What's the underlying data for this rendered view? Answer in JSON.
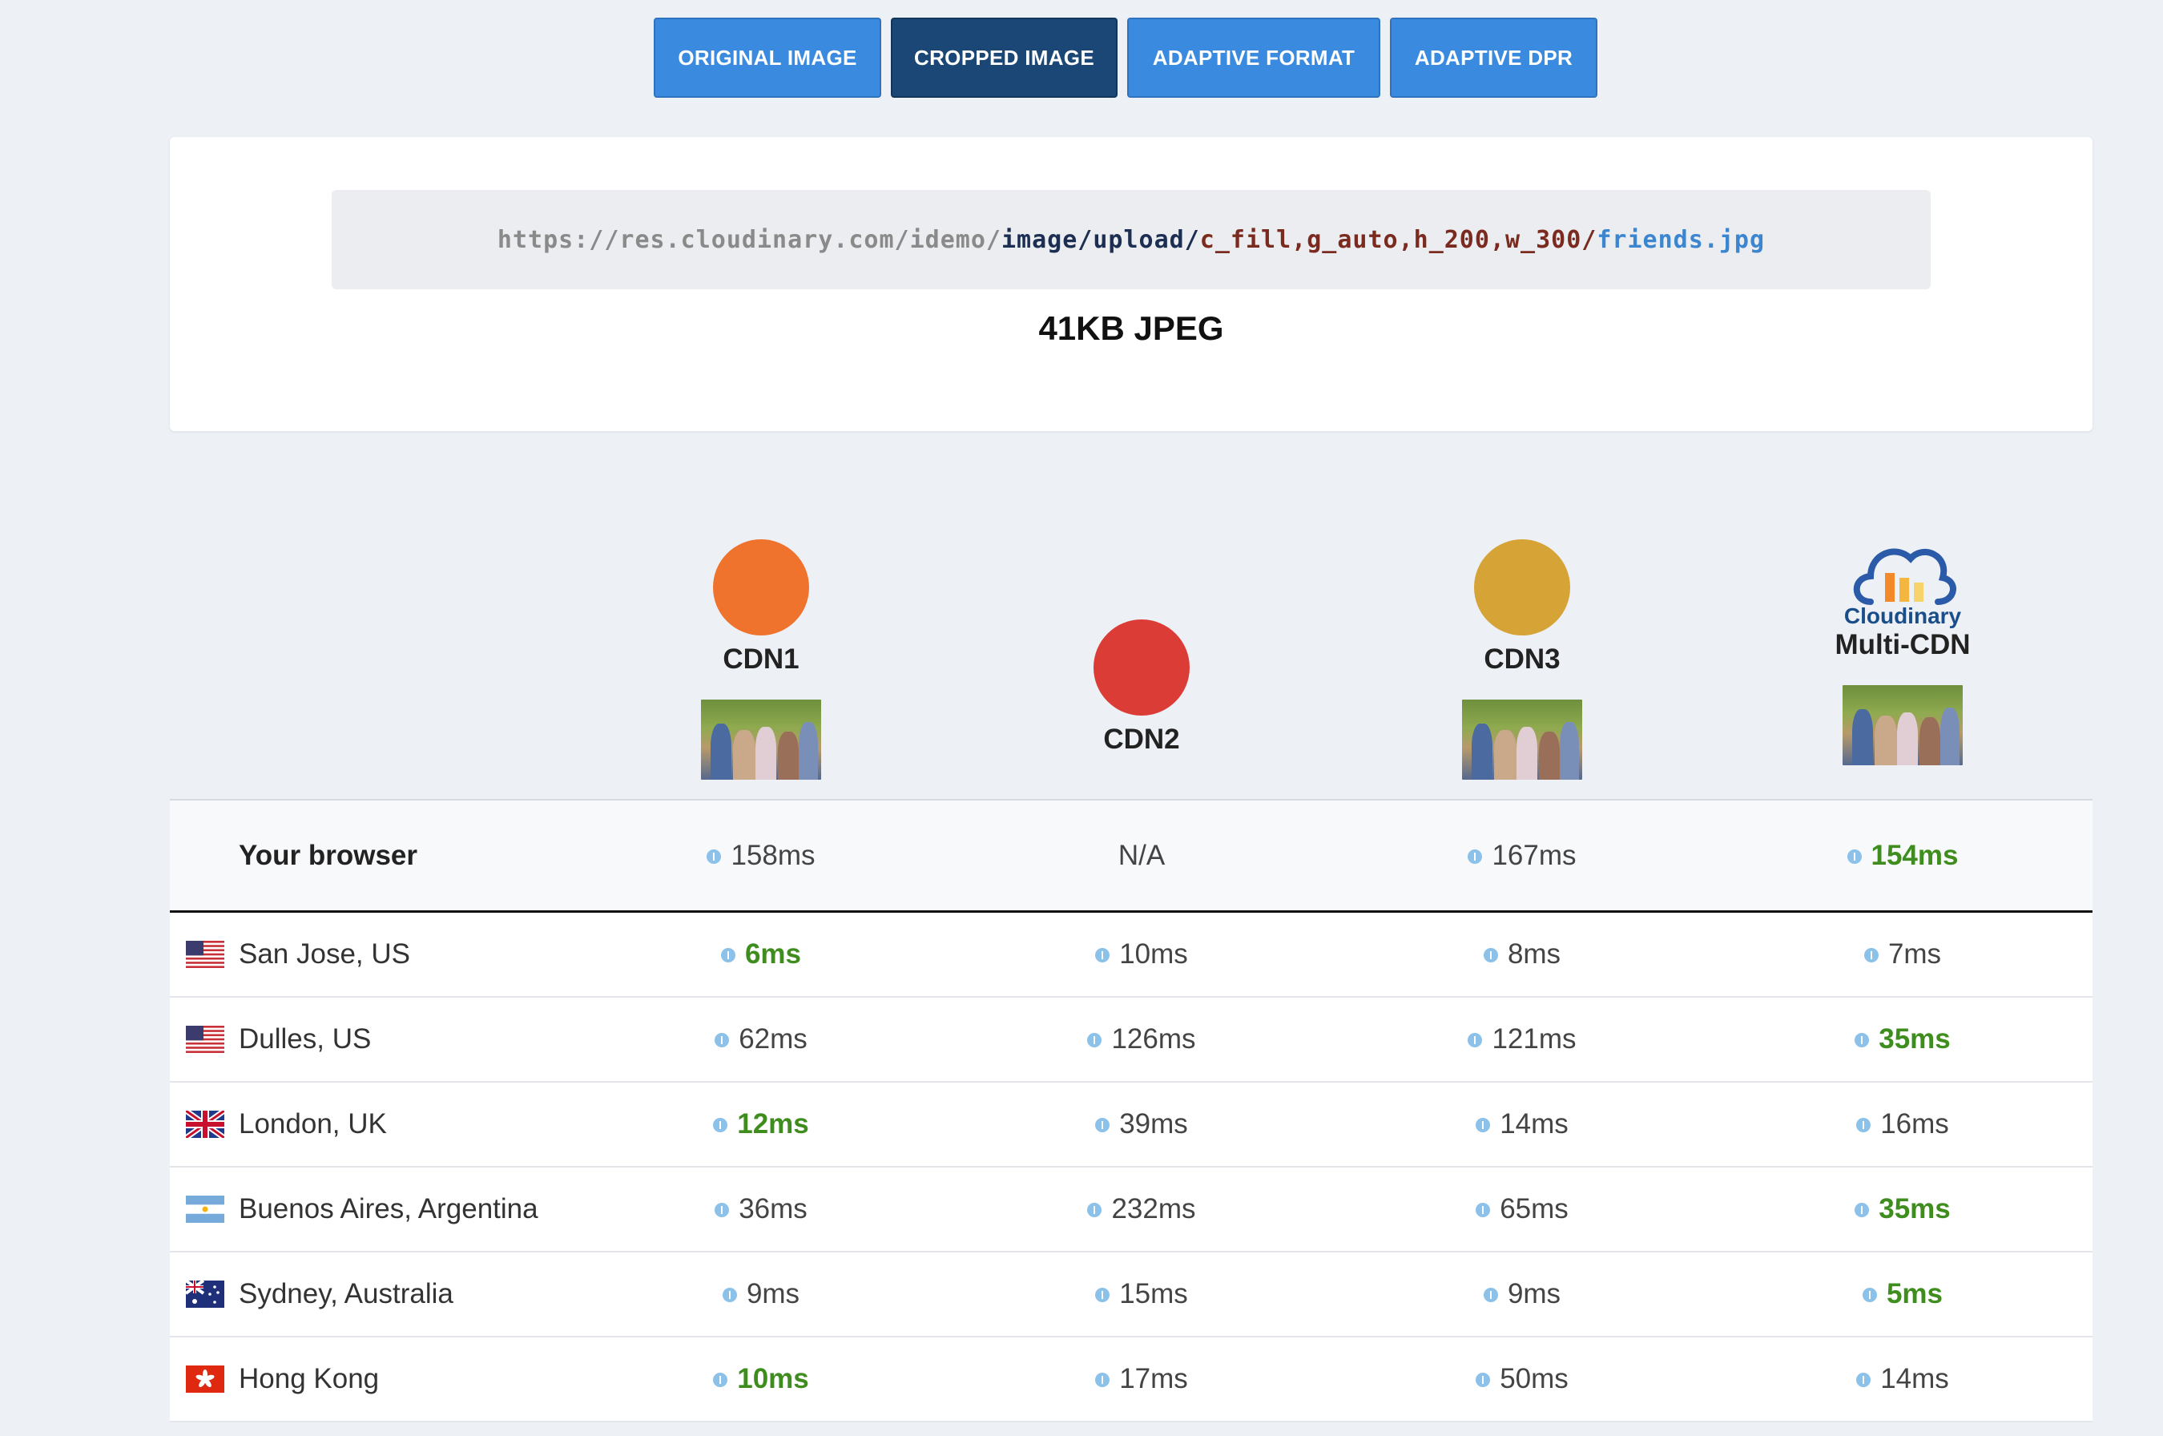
{
  "tabs": [
    {
      "label": "ORIGINAL IMAGE",
      "active": false
    },
    {
      "label": "CROPPED IMAGE",
      "active": true
    },
    {
      "label": "ADAPTIVE FORMAT",
      "active": false
    },
    {
      "label": "ADAPTIVE DPR",
      "active": false
    }
  ],
  "url": {
    "base": "https://res.cloudinary.com/idemo/",
    "type": "image/upload/",
    "transform": "c_fill,g_auto,h_200,w_300/",
    "file": "friends.jpg"
  },
  "size_label": "41KB JPEG",
  "cdns": [
    {
      "name": "CDN1",
      "color": "#ef732d",
      "has_thumb": true
    },
    {
      "name": "CDN2",
      "color": "#dc3c36",
      "has_thumb": false
    },
    {
      "name": "CDN3",
      "color": "#d6a336",
      "has_thumb": true
    },
    {
      "name": "Multi-CDN",
      "logo_text": "Cloudinary",
      "icon": "cloudinary-cloud-logo",
      "has_thumb": true
    }
  ],
  "table": {
    "rows": [
      {
        "location": "Your browser",
        "flag": "",
        "cells": [
          {
            "value": "158ms",
            "best": false,
            "info": true
          },
          {
            "value": "N/A",
            "best": false,
            "info": false
          },
          {
            "value": "167ms",
            "best": false,
            "info": true
          },
          {
            "value": "154ms",
            "best": true,
            "info": true
          }
        ]
      },
      {
        "location": "San Jose, US",
        "flag": "us-flag",
        "cells": [
          {
            "value": "6ms",
            "best": true,
            "info": true
          },
          {
            "value": "10ms",
            "best": false,
            "info": true
          },
          {
            "value": "8ms",
            "best": false,
            "info": true
          },
          {
            "value": "7ms",
            "best": false,
            "info": true
          }
        ]
      },
      {
        "location": "Dulles, US",
        "flag": "us-flag",
        "cells": [
          {
            "value": "62ms",
            "best": false,
            "info": true
          },
          {
            "value": "126ms",
            "best": false,
            "info": true
          },
          {
            "value": "121ms",
            "best": false,
            "info": true
          },
          {
            "value": "35ms",
            "best": true,
            "info": true
          }
        ]
      },
      {
        "location": "London, UK",
        "flag": "uk-flag",
        "cells": [
          {
            "value": "12ms",
            "best": true,
            "info": true
          },
          {
            "value": "39ms",
            "best": false,
            "info": true
          },
          {
            "value": "14ms",
            "best": false,
            "info": true
          },
          {
            "value": "16ms",
            "best": false,
            "info": true
          }
        ]
      },
      {
        "location": "Buenos Aires, Argentina",
        "flag": "ar-flag",
        "cells": [
          {
            "value": "36ms",
            "best": false,
            "info": true
          },
          {
            "value": "232ms",
            "best": false,
            "info": true
          },
          {
            "value": "65ms",
            "best": false,
            "info": true
          },
          {
            "value": "35ms",
            "best": true,
            "info": true
          }
        ]
      },
      {
        "location": "Sydney, Australia",
        "flag": "au-flag",
        "cells": [
          {
            "value": "9ms",
            "best": false,
            "info": true
          },
          {
            "value": "15ms",
            "best": false,
            "info": true
          },
          {
            "value": "9ms",
            "best": false,
            "info": true
          },
          {
            "value": "5ms",
            "best": true,
            "info": true
          }
        ]
      },
      {
        "location": "Hong Kong",
        "flag": "hk-flag",
        "cells": [
          {
            "value": "10ms",
            "best": true,
            "info": true
          },
          {
            "value": "17ms",
            "best": false,
            "info": true
          },
          {
            "value": "50ms",
            "best": false,
            "info": true
          },
          {
            "value": "14ms",
            "best": false,
            "info": true
          }
        ]
      }
    ]
  }
}
